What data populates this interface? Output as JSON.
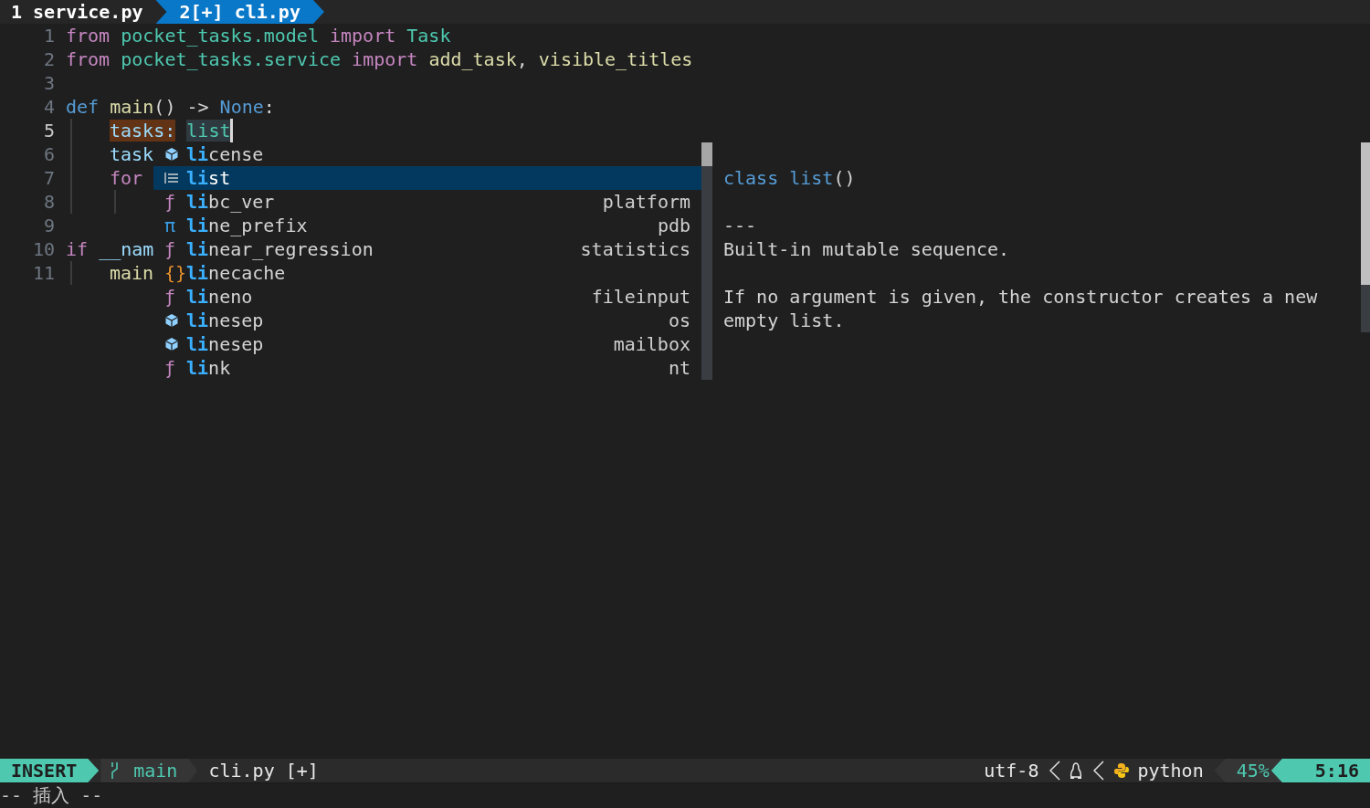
{
  "tabs": [
    {
      "label": "1 service.py",
      "selected": false
    },
    {
      "label": "2[+] cli.py",
      "selected": true
    }
  ],
  "editor": {
    "lines": [
      {
        "number": "1",
        "current": false,
        "tokens": [
          {
            "text": "from",
            "kind": "keyword"
          },
          {
            "text": " pocket_tasks.model",
            "kind": "module"
          },
          {
            "text": " import",
            "kind": "keyword"
          },
          {
            "text": " Task",
            "kind": "module"
          }
        ]
      },
      {
        "number": "2",
        "current": false,
        "tokens": [
          {
            "text": "from",
            "kind": "keyword"
          },
          {
            "text": " pocket_tasks.service",
            "kind": "module"
          },
          {
            "text": " import",
            "kind": "keyword"
          },
          {
            "text": " add_task",
            "kind": "function"
          },
          {
            "text": ",",
            "kind": "plain"
          },
          {
            "text": " visible_titles",
            "kind": "function"
          }
        ]
      },
      {
        "number": "3",
        "current": false
      },
      {
        "number": "4",
        "current": false,
        "tokens": [
          {
            "text": "def",
            "kind": "storage"
          },
          {
            "text": " main",
            "kind": "function"
          },
          {
            "text": "() ->",
            "kind": "plain"
          },
          {
            "text": " None",
            "kind": "storage"
          },
          {
            "text": ":",
            "kind": "plain"
          }
        ],
        "children": [
          {
            "number": "5",
            "current": true,
            "cursor": true,
            "tokens": [
              {
                "text": "tasks:",
                "kind": "variable",
                "write_highlight": true
              },
              {
                "text": " list",
                "kind": "module",
                "read_highlight": true
              }
            ]
          },
          {
            "number": "6",
            "current": false,
            "tokens": [
              {
                "text": "task",
                "kind": "variable"
              }
            ]
          },
          {
            "number": "7",
            "current": false,
            "tokens": [
              {
                "text": "for",
                "kind": "keyword"
              }
            ],
            "children": [
              {
                "number": "8",
                "current": false
              }
            ]
          }
        ]
      },
      {
        "number": "9",
        "current": false
      },
      {
        "number": "10",
        "current": false,
        "tokens": [
          {
            "text": "if",
            "kind": "keyword"
          },
          {
            "text": " __nam",
            "kind": "variable"
          }
        ],
        "children": [
          {
            "number": "11",
            "current": false,
            "tokens": [
              {
                "text": "main",
                "kind": "function"
              }
            ]
          }
        ]
      }
    ]
  },
  "completion": {
    "items": [
      {
        "kind": "module",
        "label": "**li**cense",
        "selected": false
      },
      {
        "kind": "class",
        "label": "**li**st",
        "selected": true
      },
      {
        "kind": "function",
        "icon": "ƒ",
        "label": "**li**bc_ver",
        "source": "platform",
        "selected": false
      },
      {
        "kind": "constant",
        "icon": "π",
        "label": "**li**ne_prefix",
        "source": "pdb",
        "selected": false
      },
      {
        "kind": "function",
        "icon": "ƒ",
        "label": "**li**near_regression",
        "source": "statistics",
        "selected": false
      },
      {
        "kind": "namespace",
        "icon": "{}",
        "label": "**li**necache",
        "selected": false
      },
      {
        "kind": "function",
        "icon": "ƒ",
        "label": "**li**neno",
        "source": "fileinput",
        "selected": false
      },
      {
        "kind": "module",
        "label": "**li**nesep",
        "source": "os",
        "selected": false
      },
      {
        "kind": "module",
        "label": "**li**nesep",
        "source": "mailbox",
        "selected": false
      },
      {
        "kind": "function",
        "icon": "ƒ",
        "label": "**li**nk",
        "source": "nt",
        "selected": false
      }
    ]
  },
  "documentation": {
    "signature": [
      {
        "text": "class list",
        "kind": "storage"
      },
      {
        "text": "()",
        "kind": "plain"
      }
    ],
    "separator": "---",
    "paragraphs": [
      "Built-in mutable sequence.",
      "If no argument is given, the constructor creates a new empty list."
    ]
  },
  "status_bar": {
    "mode": "INSERT",
    "branch": "main",
    "file": "cli.py [+]",
    "encoding": "utf-8",
    "filetype": "python",
    "percent": "45%",
    "position": "5:16"
  },
  "command_line": "-- 插入 --"
}
